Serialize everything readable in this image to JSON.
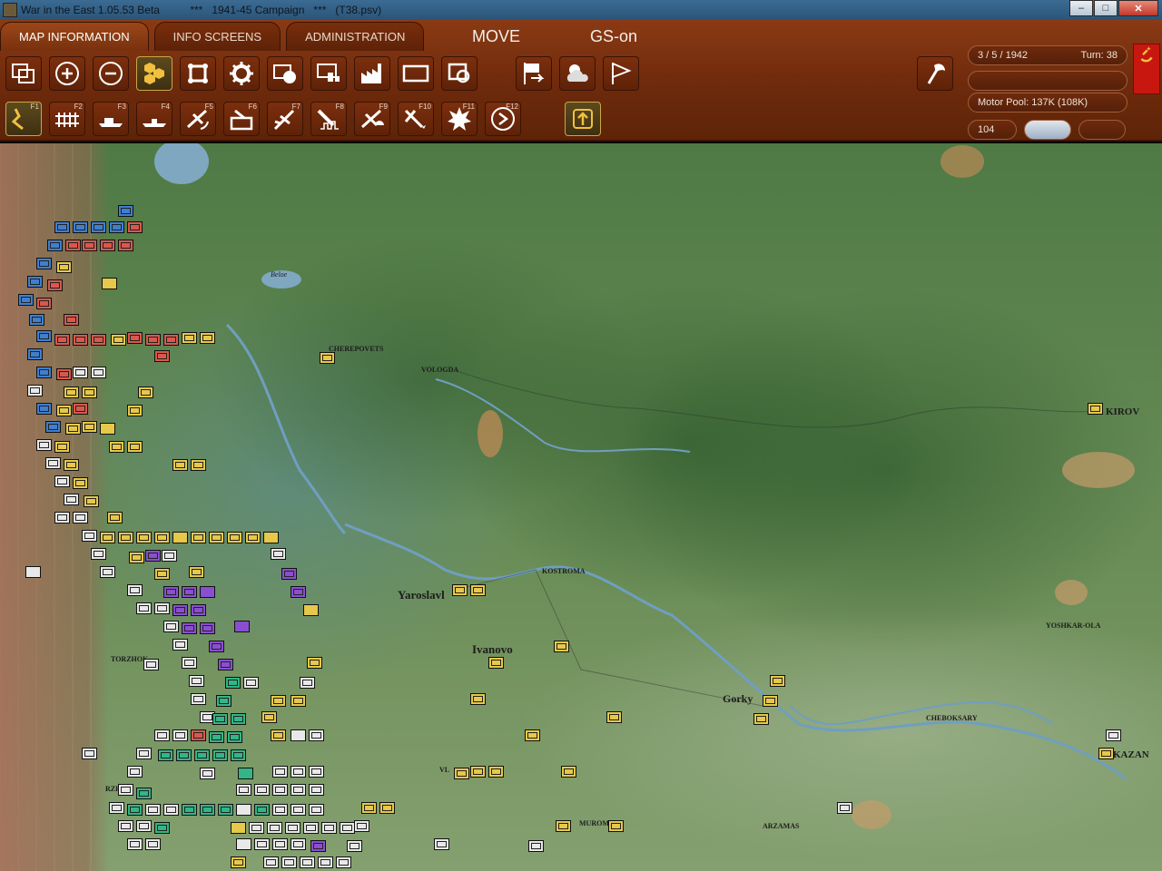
{
  "window": {
    "title": "War in the East 1.05.53 Beta          ***   1941-45 Campaign   ***   (T38.psv)",
    "min": "–",
    "max": "□",
    "close": "✕"
  },
  "tabs": [
    {
      "label": "MAP INFORMATION"
    },
    {
      "label": "INFO SCREENS"
    },
    {
      "label": "ADMINISTRATION"
    }
  ],
  "mode": {
    "move": "MOVE",
    "gs": "GS-on"
  },
  "toolbar_row1": [
    "hex-overlay-icon",
    "zoom-in-icon",
    "zoom-out-icon",
    "hex-cluster-icon",
    "frame-icon",
    "gear-icon",
    "unit-shape-icon",
    "display-icon",
    "factory-icon",
    "rectangle-icon",
    "target-frame-icon",
    "flag-arrow-icon",
    "weather-icon",
    "flag-icon",
    "axe-icon"
  ],
  "toolbar_row2": [
    {
      "icon": "path-icon",
      "key": "F1"
    },
    {
      "icon": "rail-icon",
      "key": "F2"
    },
    {
      "icon": "naval-icon",
      "key": "F3"
    },
    {
      "icon": "ship-icon",
      "key": "F4"
    },
    {
      "icon": "air-recon-icon",
      "key": "F5"
    },
    {
      "icon": "airfield-icon",
      "key": "F6"
    },
    {
      "icon": "air-strike-icon",
      "key": "F7"
    },
    {
      "icon": "ground-attack-icon",
      "key": "F8"
    },
    {
      "icon": "paradrop-icon",
      "key": "F9"
    },
    {
      "icon": "interdiction-icon",
      "key": "F10"
    },
    {
      "icon": "explosion-icon",
      "key": "F11"
    },
    {
      "icon": "advance-icon",
      "key": "F12"
    },
    {
      "icon": "upload-icon",
      "key": ""
    }
  ],
  "status": {
    "date": "3 / 5 / 1942",
    "turn_label": "Turn: 38",
    "motor_pool": "Motor Pool:  137K (108K)",
    "value": "104"
  },
  "map_labels": {
    "cherepovets": "CHEREPOVETS",
    "vologda": "VOLOGDA",
    "beloe": "Beloe",
    "kirov": "KIROV",
    "kostroma": "KOSTROMA",
    "yaroslavl": "Yaroslavl",
    "ivanovo": "Ivanovo",
    "gorky": "Gorky",
    "yoshkar": "YOSHKAR-OLA",
    "cheboksary": "CHEBOKSARY",
    "kazan": "KAZAN",
    "murom": "MUROM",
    "arzamas": "ARZAMAS",
    "torzhok": "TORZHOK",
    "rzhev": "RZHEV",
    "vladimir": "VL"
  }
}
